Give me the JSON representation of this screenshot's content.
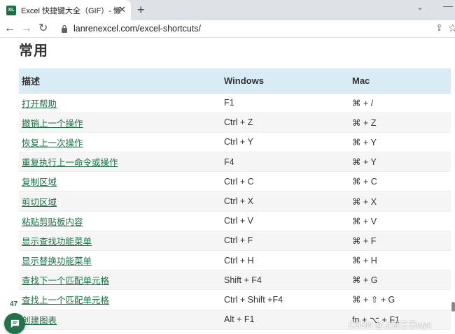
{
  "browser": {
    "tab_title": "Excel 快捷键大全（GIF）- 懒人Excel",
    "favicon_text": "XL",
    "url": "lanrenexcel.com/excel-shortcuts/",
    "icons": [
      "close-icon",
      "new-tab-icon",
      "back-icon",
      "forward-icon",
      "reload-icon",
      "lock-icon",
      "share-icon",
      "star-icon"
    ]
  },
  "page": {
    "heading": "常用",
    "table": {
      "headers": [
        "描述",
        "Windows",
        "Mac"
      ],
      "rows": [
        {
          "desc": "打开帮助",
          "windows": "F1",
          "mac": "⌘ + /"
        },
        {
          "desc": "撤销上一个操作",
          "windows": "Ctrl + Z",
          "mac": "⌘ + Z"
        },
        {
          "desc": "恢复上一次操作",
          "windows": "Ctrl + Y",
          "mac": "⌘ + Y"
        },
        {
          "desc": "重复执行上一命令或操作",
          "windows": "F4",
          "mac": "⌘ + Y"
        },
        {
          "desc": "复制区域",
          "windows": "Ctrl + C",
          "mac": "⌘ + C"
        },
        {
          "desc": "剪切区域",
          "windows": "Ctrl + X",
          "mac": "⌘ + X"
        },
        {
          "desc": "粘贴剪贴板内容",
          "windows": "Ctrl + V",
          "mac": "⌘ + V"
        },
        {
          "desc": "显示查找功能菜单",
          "windows": "Ctrl + F",
          "mac": "⌘ + F"
        },
        {
          "desc": "显示替换功能菜单",
          "windows": "Ctrl + H",
          "mac": "⌘ + H"
        },
        {
          "desc": "查找下一个匹配单元格",
          "windows": "Shift + F4",
          "mac": "⌘ + G"
        },
        {
          "desc": "查找上一个匹配单元格",
          "windows": "Ctrl + Shift +F4",
          "mac": "⌘ + ⇧ + G"
        },
        {
          "desc": "创建图表",
          "windows": "Alt + F1",
          "mac": "fn + ⌥ + F1"
        }
      ]
    },
    "comment_count": "47",
    "watermark": "CSDN @上别三日wyx"
  },
  "colors": {
    "header_bg": "#d9ebf5",
    "link": "#1e7145",
    "fab": "#24704a"
  }
}
